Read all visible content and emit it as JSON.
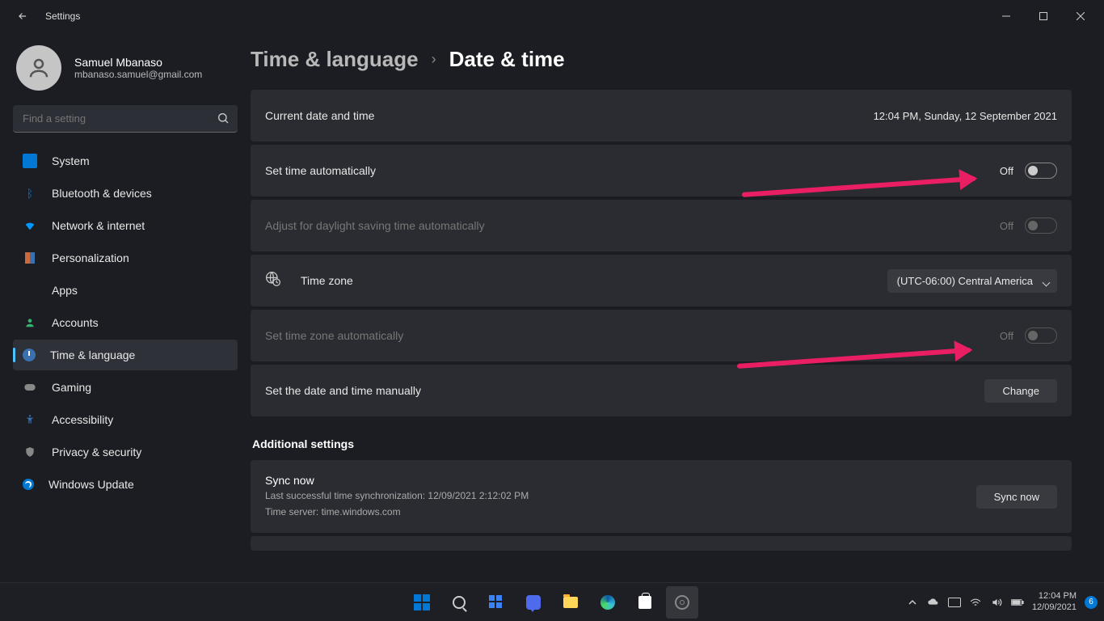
{
  "window": {
    "title": "Settings"
  },
  "profile": {
    "name": "Samuel Mbanaso",
    "email": "mbanaso.samuel@gmail.com"
  },
  "search": {
    "placeholder": "Find a setting"
  },
  "nav": {
    "items": [
      {
        "label": "System"
      },
      {
        "label": "Bluetooth & devices"
      },
      {
        "label": "Network & internet"
      },
      {
        "label": "Personalization"
      },
      {
        "label": "Apps"
      },
      {
        "label": "Accounts"
      },
      {
        "label": "Time & language"
      },
      {
        "label": "Gaming"
      },
      {
        "label": "Accessibility"
      },
      {
        "label": "Privacy & security"
      },
      {
        "label": "Windows Update"
      }
    ]
  },
  "breadcrumb": {
    "parent": "Time & language",
    "current": "Date & time"
  },
  "settings": {
    "current_label": "Current date and time",
    "current_value": "12:04 PM, Sunday, 12 September 2021",
    "auto_time_label": "Set time automatically",
    "auto_time_state": "Off",
    "dst_label": "Adjust for daylight saving time automatically",
    "dst_state": "Off",
    "tz_label": "Time zone",
    "tz_value": "(UTC-06:00) Central America",
    "auto_tz_label": "Set time zone automatically",
    "auto_tz_state": "Off",
    "manual_label": "Set the date and time manually",
    "manual_btn": "Change",
    "additional_header": "Additional settings",
    "sync_title": "Sync now",
    "sync_line1": "Last successful time synchronization: 12/09/2021 2:12:02 PM",
    "sync_line2": "Time server: time.windows.com",
    "sync_btn": "Sync now"
  },
  "taskbar": {
    "time": "12:04 PM",
    "date": "12/09/2021",
    "badge": "6"
  }
}
